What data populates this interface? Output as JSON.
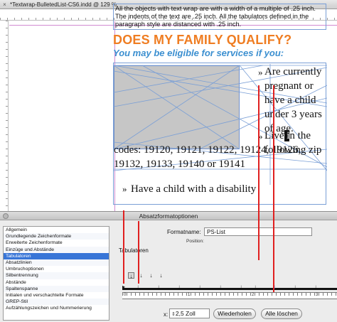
{
  "document": {
    "title": "*Textwrap-BulletedList-CS6.indd @ 129 %",
    "note": "All the objects with text wrap are with a width of a multiple of .25 inch. The indents of the text are .25 inch. All the tabulators defined in the paragraph style are distanced with .25 inch.",
    "heading": "DOES MY FAMILY QUALIFY?",
    "subheading": "You may be eligible for services if you:",
    "bullet_glyph": "»",
    "bullet1_text": "Are currently pregnant or have a child under 3 years of age.",
    "bullet2_pre": "Live",
    "bullet2_sel": " i",
    "bullet2_post": "n the following zip",
    "bullet2_cont": "codes: 19120, 19121, 19122, 19124, 19126, 19132, 19133, 19140 or 19141",
    "bullet3_text": "Have a child with a disability"
  },
  "dialog": {
    "title": "Absatzformatoptionen",
    "categories": [
      "Allgemein",
      "Grundlegende Zeichenformate",
      "Erweiterte Zeichenformate",
      "Einzüge und Abstände",
      "Tabulatoren",
      "Absatzlinien",
      "Umbruchoptionen",
      "Silbentrennung",
      "Abstände",
      "Spaltenspanne",
      "Initialen und verschachtelte Formate",
      "GREP-Stil",
      "Aufzählungszeichen und Nummerierung"
    ],
    "selected_category": "Tabulatoren",
    "formatname_label": "Formatname:",
    "formatname_value": "PS-List",
    "position_label": "Position:",
    "section_label": "Tabulatoren",
    "tab_buttons": [
      "↓",
      "↓",
      "↓",
      "↓"
    ],
    "x_label": "x:",
    "x_value": "2,5 Zoll",
    "repeat_button": "Wiederholen",
    "clear_all_button": "Alle löschen",
    "ruler_numbers": [
      "0",
      "1",
      "2",
      "3"
    ]
  },
  "colors": {
    "heading": "#ef7d22",
    "subheading": "#3b8fd0",
    "frame_edge": "#7a9fd6",
    "guide_line": "#e02020",
    "selection": "#3875d7"
  }
}
